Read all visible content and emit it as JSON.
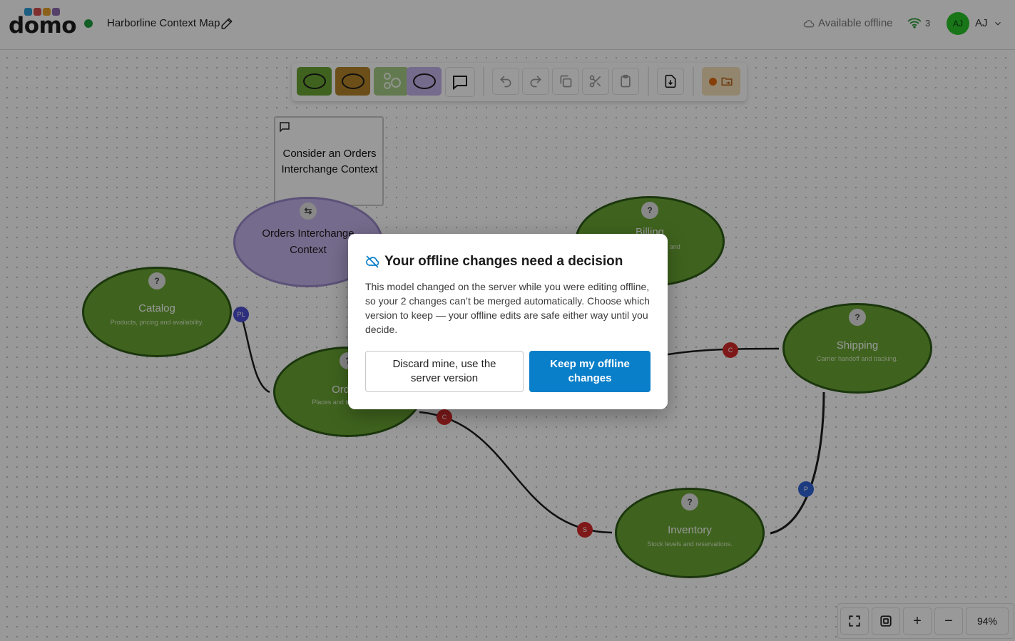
{
  "header": {
    "logo_text": "domo",
    "logo_dot_colors": [
      "#2f9fd6",
      "#d64f4f",
      "#e8a12a",
      "#8d6bb0"
    ],
    "title": "Harborline Context Map",
    "status_color": "#1e9e3f",
    "offline_label": "Available offline",
    "connection_count": "3",
    "avatar_initials": "AJ",
    "avatar_color": "#28c428",
    "user_label": "AJ"
  },
  "note": {
    "text": "Consider an Orders Interchange Context"
  },
  "nodes": {
    "catalog": {
      "name": "Catalog",
      "description": "Products, pricing and availability.",
      "marker": "?"
    },
    "orders_interchange": {
      "name": "Orders Interchange Context"
    },
    "billing": {
      "name": "Billing",
      "description": "Invoices, refunds and",
      "marker": "?"
    },
    "orders": {
      "name": "Orders",
      "description": "Places and tracks orders.",
      "marker": "?"
    },
    "shipping": {
      "name": "Shipping",
      "description": "Carrier handoff and tracking.",
      "marker": "?"
    },
    "inventory": {
      "name": "Inventory",
      "description": "Stock levels and reservations.",
      "marker": "?"
    }
  },
  "relationship_badges": {
    "catalog_orders": "PL",
    "orders_shipping": "C",
    "orders_inventory_upstream": "C",
    "orders_inventory_downstream": "S",
    "inventory_shipping": "P"
  },
  "zoom": {
    "level": "94%",
    "plus": "+",
    "minus": "−"
  },
  "dialog": {
    "title": "Your offline changes need a decision",
    "body": "This model changed on the server while you were editing offline, so your 2 changes can’t be merged automatically. Choose which version to keep — your offline edits are safe either way until you decide.",
    "discard_label": "Discard mine, use the server version",
    "keep_label": "Keep my offline changes"
  },
  "colors": {
    "primary": "#0a7fc9",
    "node_green": "#6aa532",
    "badge_red": "#d42a2a",
    "badge_blue": "#2f63d6",
    "badge_indigo": "#4d4fd0"
  }
}
